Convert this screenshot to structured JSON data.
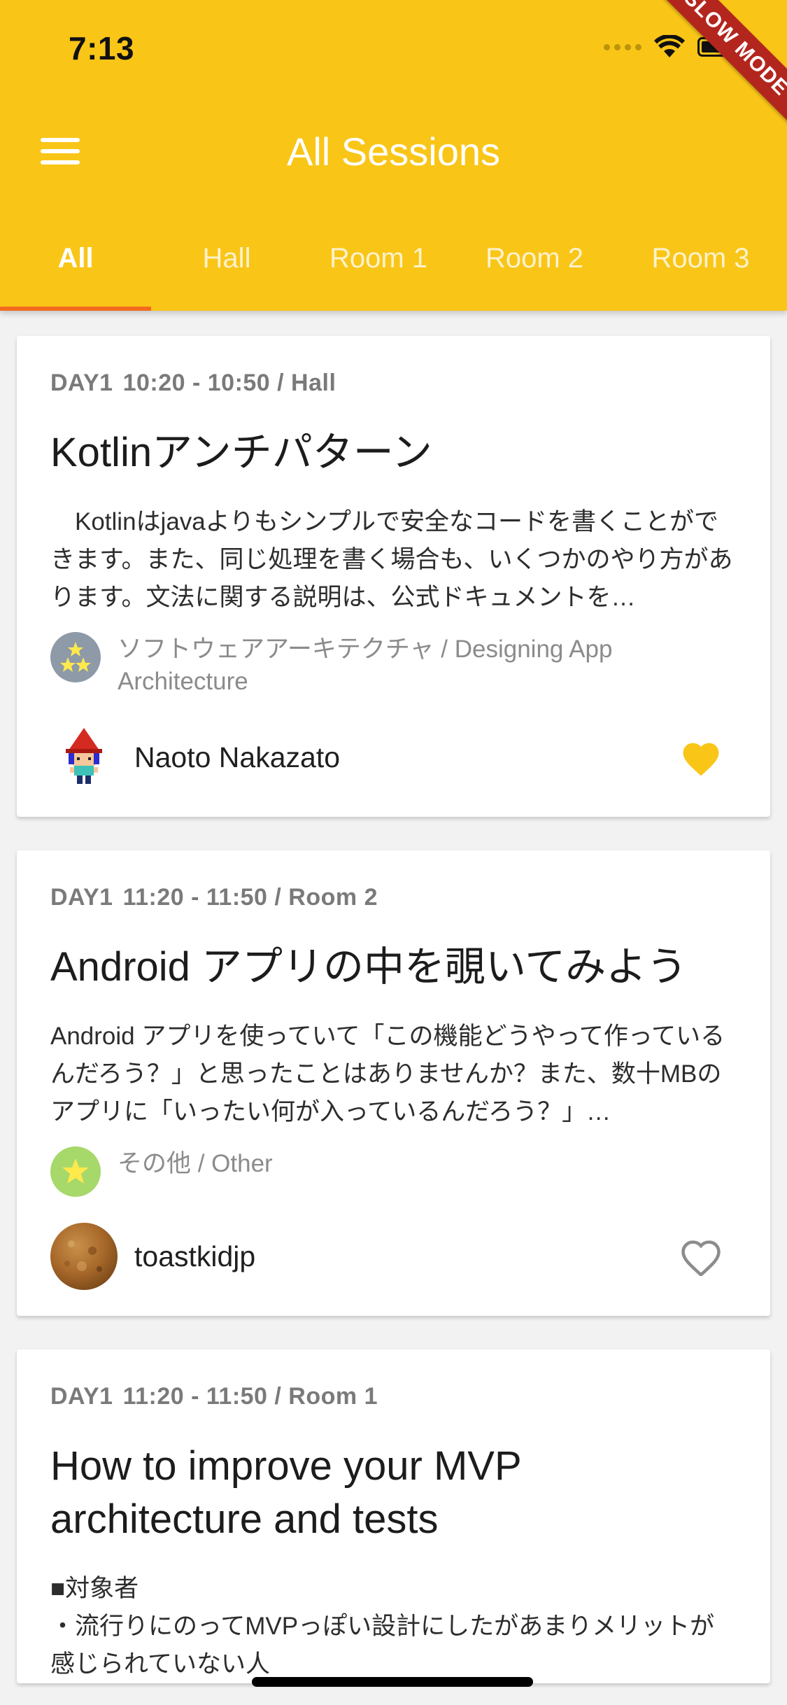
{
  "status_bar": {
    "time": "7:13"
  },
  "debug_banner": "SLOW MODE",
  "app_bar": {
    "title": "All Sessions"
  },
  "tabs": [
    {
      "label": "All"
    },
    {
      "label": "Hall"
    },
    {
      "label": "Room 1"
    },
    {
      "label": "Room 2"
    },
    {
      "label": "Room 3"
    }
  ],
  "sessions": [
    {
      "day": "DAY1",
      "time_room": "10:20 - 10:50 / Hall",
      "title": "Kotlinアンチパターン",
      "description": "　Kotlinはjavaよりもシンプルで安全なコードを書くことができます。また、同じ処理を書く場合も、いくつかのやり方があります。文法に関する説明は、公式ドキュメントを…",
      "category": "ソフトウェアアーキテクチャ / Designing App Architecture",
      "category_icon": "two-stars-icon",
      "category_color": "#8e9aa8",
      "speaker": "Naoto Nakazato",
      "favorited": true
    },
    {
      "day": "DAY1",
      "time_room": "11:20 - 11:50 / Room 2",
      "title": "Android アプリの中を覗いてみよう",
      "description": "Android アプリを使っていて「この機能どうやって作っているんだろう？」と思ったことはありませんか？また、数十MBのアプリに「いったい何が入っているんだろう？」…",
      "category": "その他 / Other",
      "category_icon": "star-icon",
      "category_color": "#a6d86a",
      "speaker": "toastkidjp",
      "favorited": false
    },
    {
      "day": "DAY1",
      "time_room": "11:20 - 11:50 / Room 1",
      "title": "How to improve your MVP architecture and tests",
      "description": "■対象者\n・流行りにのってMVPっぽい設計にしたがあまりメリットが感じられていない人"
    }
  ],
  "colors": {
    "app_bar": "#f9c517",
    "tab_indicator": "#f26b1d",
    "favorite_active": "#f9c517",
    "favorite_inactive": "#8c8c8c"
  }
}
